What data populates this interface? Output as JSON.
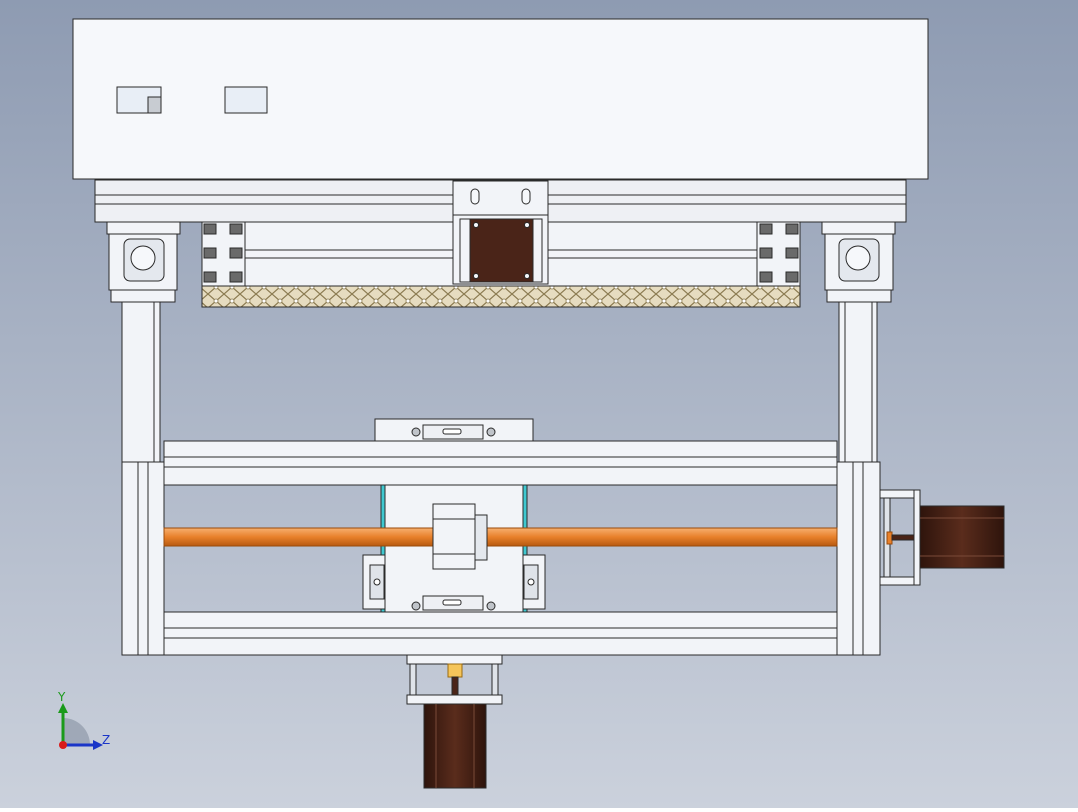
{
  "view": {
    "background_top": "#8e9bb2",
    "background_bottom": "#cbd1dc"
  },
  "model": {
    "frame_color": "#f2f4f8",
    "edge_color": "#2a2a2a",
    "screw_color": "#e8802a",
    "motor_color": "#4a2418",
    "nut_color": "#f5c55a",
    "slot_color": "#6a6a6a"
  },
  "triad": {
    "y_label": "Y",
    "z_label": "Z",
    "y_color": "#1a9a1a",
    "z_color": "#1a35c8",
    "x_color": "#d81a1a"
  }
}
